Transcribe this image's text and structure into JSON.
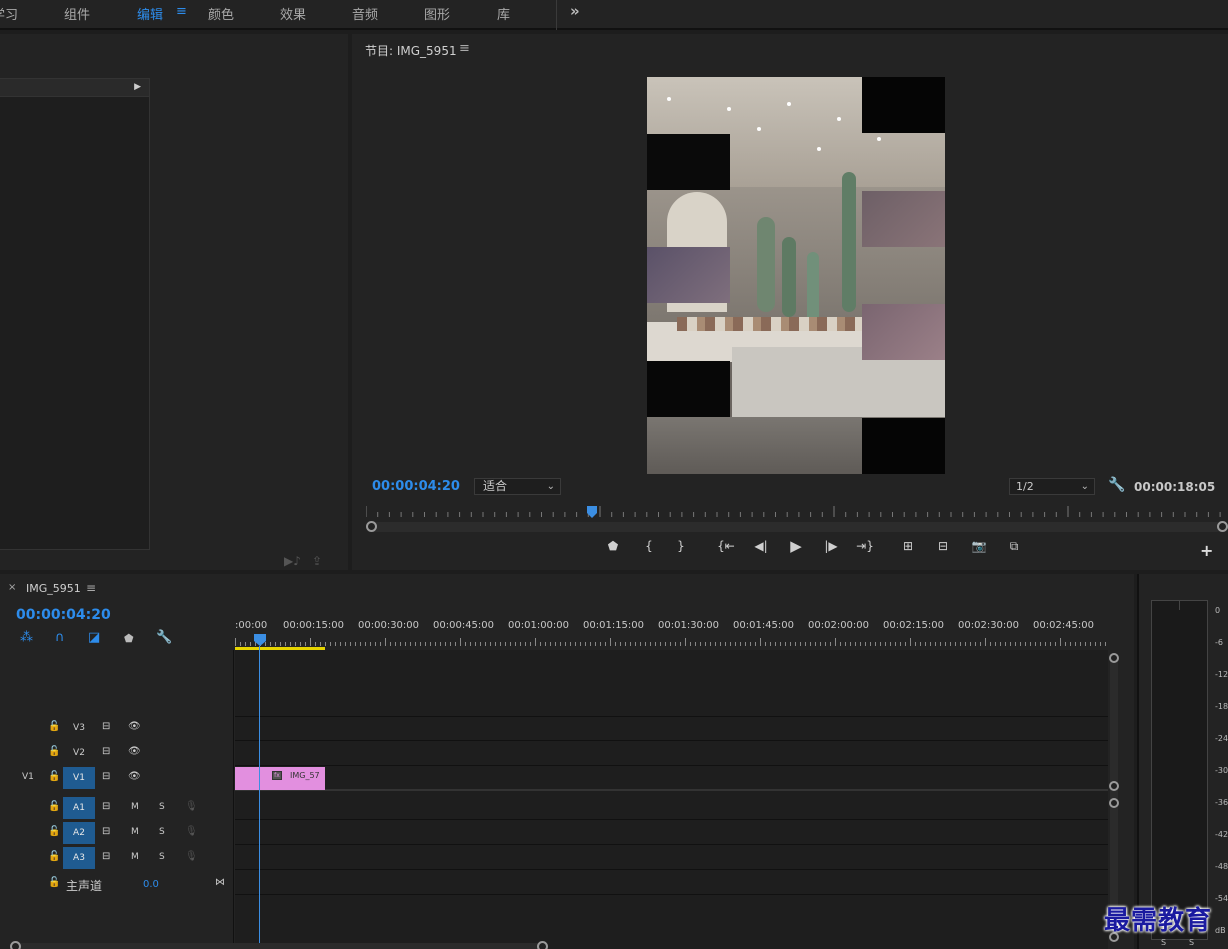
{
  "workspace_tabs": [
    {
      "label": "学习",
      "active": false
    },
    {
      "label": "组件",
      "active": false
    },
    {
      "label": "编辑",
      "active": true
    },
    {
      "label": "颜色",
      "active": false
    },
    {
      "label": "效果",
      "active": false
    },
    {
      "label": "音频",
      "active": false
    },
    {
      "label": "图形",
      "active": false
    },
    {
      "label": "库",
      "active": false
    }
  ],
  "program_monitor": {
    "title": "节目: IMG_5951",
    "timecode": "00:00:04:20",
    "fit": "适合",
    "resolution": "1/2",
    "duration": "00:00:18:05",
    "playhead_seconds": 4.8,
    "total_seconds": 18.2
  },
  "timeline": {
    "sequence_name": "IMG_5951",
    "timecode": "00:00:04:20",
    "ruler_labels": [
      ":00:00",
      "00:00:15:00",
      "00:00:30:00",
      "00:00:45:00",
      "00:01:00:00",
      "00:01:15:00",
      "00:01:30:00",
      "00:01:45:00",
      "00:02:00:00",
      "00:02:15:00",
      "00:02:30:00",
      "00:02:45:00"
    ],
    "video_tracks": [
      {
        "name": "V3",
        "source": ""
      },
      {
        "name": "V2",
        "source": ""
      },
      {
        "name": "V1",
        "source": "V1"
      }
    ],
    "audio_tracks": [
      {
        "name": "A1",
        "mute": "M",
        "solo": "S"
      },
      {
        "name": "A2",
        "mute": "M",
        "solo": "S"
      },
      {
        "name": "A3",
        "mute": "M",
        "solo": "S"
      }
    ],
    "master": {
      "label": "主声道",
      "value": "0.0"
    },
    "clip": {
      "label": "IMG_57",
      "fx": "fx",
      "color": "#e28fdf"
    }
  },
  "meter": {
    "db_labels": [
      "0",
      "-6",
      "-12",
      "-18",
      "-24",
      "-30",
      "-36",
      "-42",
      "-48",
      "-54",
      "dB"
    ],
    "solo_labels": [
      "S",
      "S"
    ]
  },
  "watermark": "最需教育",
  "colors": {
    "accent": "#2d8ceb",
    "track_target": "#1f5b91",
    "work_area": "#e6d400"
  }
}
